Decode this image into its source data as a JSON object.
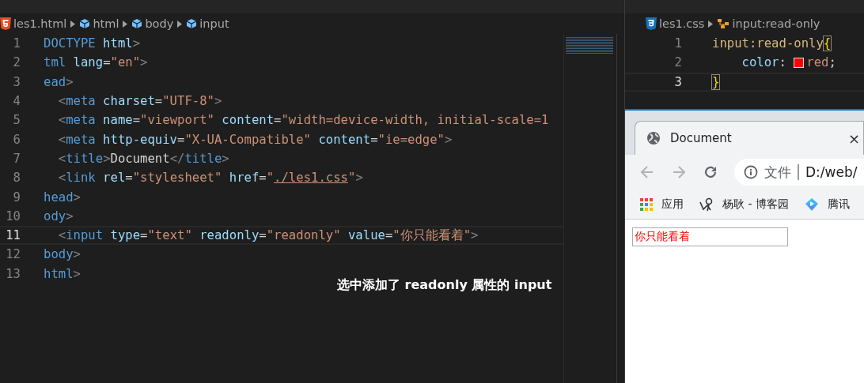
{
  "html_editor": {
    "breadcrumb": [
      {
        "label": "les1.html",
        "kind": "file"
      },
      {
        "label": "html",
        "kind": "element"
      },
      {
        "label": "body",
        "kind": "element"
      },
      {
        "label": "input",
        "kind": "element"
      }
    ],
    "lines": [
      {
        "number": "1",
        "current": false,
        "tokens": [
          {
            "kind": "tag",
            "text": "DOCTYPE"
          },
          {
            "kind": "attr",
            "text": " html"
          },
          {
            "kind": "punct",
            "text": ">"
          }
        ]
      },
      {
        "number": "2",
        "current": false,
        "tokens": [
          {
            "kind": "tag",
            "text": "tml"
          },
          {
            "kind": "attr",
            "text": " lang"
          },
          {
            "kind": "plain",
            "text": "="
          },
          {
            "kind": "str",
            "text": "\"en\""
          },
          {
            "kind": "punct",
            "text": ">"
          }
        ]
      },
      {
        "number": "3",
        "current": false,
        "tokens": [
          {
            "kind": "tag",
            "text": "ead"
          },
          {
            "kind": "punct",
            "text": ">"
          }
        ]
      },
      {
        "number": "4",
        "current": false,
        "tokens": [
          {
            "kind": "punct",
            "text": "  <"
          },
          {
            "kind": "tag",
            "text": "meta"
          },
          {
            "kind": "attr",
            "text": " charset"
          },
          {
            "kind": "plain",
            "text": "="
          },
          {
            "kind": "str",
            "text": "\"UTF-8\""
          },
          {
            "kind": "punct",
            "text": ">"
          }
        ]
      },
      {
        "number": "5",
        "current": false,
        "tokens": [
          {
            "kind": "punct",
            "text": "  <"
          },
          {
            "kind": "tag",
            "text": "meta"
          },
          {
            "kind": "attr",
            "text": " name"
          },
          {
            "kind": "plain",
            "text": "="
          },
          {
            "kind": "str",
            "text": "\"viewport\""
          },
          {
            "kind": "attr",
            "text": " content"
          },
          {
            "kind": "plain",
            "text": "="
          },
          {
            "kind": "str",
            "text": "\"width=device-width, initial-scale=1"
          }
        ]
      },
      {
        "number": "6",
        "current": false,
        "tokens": [
          {
            "kind": "punct",
            "text": "  <"
          },
          {
            "kind": "tag",
            "text": "meta"
          },
          {
            "kind": "attr",
            "text": " http-equiv"
          },
          {
            "kind": "plain",
            "text": "="
          },
          {
            "kind": "str",
            "text": "\"X-UA-Compatible\""
          },
          {
            "kind": "attr",
            "text": " content"
          },
          {
            "kind": "plain",
            "text": "="
          },
          {
            "kind": "str",
            "text": "\"ie=edge\""
          },
          {
            "kind": "punct",
            "text": ">"
          }
        ]
      },
      {
        "number": "7",
        "current": false,
        "tokens": [
          {
            "kind": "punct",
            "text": "  <"
          },
          {
            "kind": "tag",
            "text": "title"
          },
          {
            "kind": "punct",
            "text": ">"
          },
          {
            "kind": "plain",
            "text": "Document"
          },
          {
            "kind": "punct",
            "text": "</"
          },
          {
            "kind": "tag",
            "text": "title"
          },
          {
            "kind": "punct",
            "text": ">"
          }
        ]
      },
      {
        "number": "8",
        "current": false,
        "tokens": [
          {
            "kind": "punct",
            "text": "  <"
          },
          {
            "kind": "tag",
            "text": "link"
          },
          {
            "kind": "attr",
            "text": " rel"
          },
          {
            "kind": "plain",
            "text": "="
          },
          {
            "kind": "str",
            "text": "\"stylesheet\""
          },
          {
            "kind": "attr",
            "text": " href"
          },
          {
            "kind": "plain",
            "text": "="
          },
          {
            "kind": "str",
            "text": "\""
          },
          {
            "kind": "link",
            "text": "./les1.css"
          },
          {
            "kind": "str",
            "text": "\""
          },
          {
            "kind": "punct",
            "text": ">"
          }
        ]
      },
      {
        "number": "9",
        "current": false,
        "tokens": [
          {
            "kind": "tag",
            "text": "head"
          },
          {
            "kind": "punct",
            "text": ">"
          }
        ]
      },
      {
        "number": "10",
        "current": false,
        "tokens": [
          {
            "kind": "tag",
            "text": "ody"
          },
          {
            "kind": "punct",
            "text": ">"
          }
        ]
      },
      {
        "number": "11",
        "current": true,
        "tokens": [
          {
            "kind": "punct",
            "text": "  <"
          },
          {
            "kind": "tag",
            "text": "input"
          },
          {
            "kind": "attr",
            "text": " type"
          },
          {
            "kind": "plain",
            "text": "="
          },
          {
            "kind": "str",
            "text": "\"text\""
          },
          {
            "kind": "attr",
            "text": " readonly"
          },
          {
            "kind": "plain",
            "text": "="
          },
          {
            "kind": "str",
            "text": "\"readonly\""
          },
          {
            "kind": "attr",
            "text": " value"
          },
          {
            "kind": "plain",
            "text": "="
          },
          {
            "kind": "str",
            "text": "\"你只能看着\""
          },
          {
            "kind": "punct",
            "text": ">"
          }
        ]
      },
      {
        "number": "12",
        "current": false,
        "tokens": [
          {
            "kind": "tag",
            "text": "body"
          },
          {
            "kind": "punct",
            "text": ">"
          }
        ]
      },
      {
        "number": "13",
        "current": false,
        "tokens": [
          {
            "kind": "tag",
            "text": "html"
          },
          {
            "kind": "punct",
            "text": ">"
          }
        ]
      }
    ]
  },
  "caption": "选中添加了 readonly 属性的 input",
  "css_editor": {
    "breadcrumb": [
      {
        "label": "les1.css",
        "kind": "file"
      },
      {
        "label": "input:read-only",
        "kind": "selector"
      }
    ],
    "lines": [
      {
        "number": "1",
        "current": false,
        "tokens": [
          {
            "kind": "selector",
            "text": "input:read-only"
          },
          {
            "kind": "bracket",
            "text": "{"
          }
        ]
      },
      {
        "number": "2",
        "current": false,
        "tokens": [
          {
            "kind": "attr",
            "text": "    color"
          },
          {
            "kind": "plain",
            "text": ": "
          },
          {
            "kind": "swatch",
            "color": "#ff0000"
          },
          {
            "kind": "str",
            "text": "red"
          },
          {
            "kind": "plain",
            "text": ";"
          }
        ]
      },
      {
        "number": "3",
        "current": true,
        "tokens": [
          {
            "kind": "bracket",
            "text": "}"
          }
        ]
      }
    ]
  },
  "browser": {
    "tab": {
      "title": "Document",
      "close": "×"
    },
    "address": {
      "scheme": "文件",
      "url": "D:/web/"
    },
    "bookmarks": [
      {
        "label": "应用"
      },
      {
        "label": "杨耿 - 博客园"
      },
      {
        "label": "腾讯"
      }
    ],
    "input_value": "你只能看着"
  }
}
